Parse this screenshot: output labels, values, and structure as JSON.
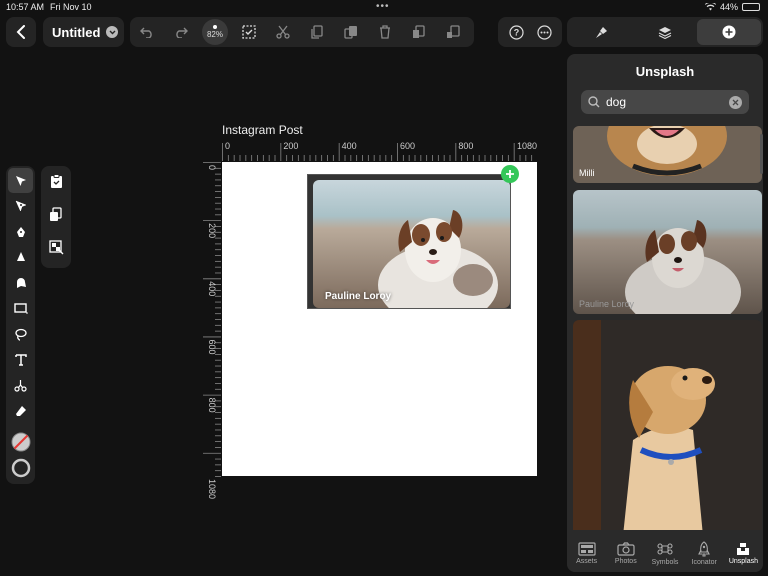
{
  "status": {
    "time": "10:57 AM",
    "date": "Fri Nov 10",
    "battery": "44%",
    "battery_level": 0.44
  },
  "header": {
    "title": "Untitled",
    "zoom": "82%"
  },
  "canvas": {
    "artboard_label": "Instagram Post",
    "ruler_h_ticks": [
      "0",
      "200",
      "400",
      "600",
      "800",
      "1080"
    ],
    "ruler_v_ticks": [
      "0",
      "200",
      "400",
      "600",
      "800",
      "1080"
    ],
    "selected_image_caption": "Pauline Loroy"
  },
  "sidebar": {
    "title": "Unsplash",
    "search": {
      "value": "dog",
      "placeholder": "Search"
    },
    "results": [
      {
        "author": "Milli"
      },
      {
        "author": "Pauline Loroy"
      },
      {
        "author": ""
      }
    ],
    "tabs": [
      {
        "label": "Assets",
        "icon": "assets-icon"
      },
      {
        "label": "Photos",
        "icon": "camera-icon"
      },
      {
        "label": "Symbols",
        "icon": "command-icon"
      },
      {
        "label": "Iconator",
        "icon": "rocket-icon"
      },
      {
        "label": "Unsplash",
        "icon": "unsplash-icon",
        "active": true
      }
    ]
  },
  "colors": {
    "accent_green": "#34c759",
    "panel": "#242424",
    "background": "#121212"
  }
}
